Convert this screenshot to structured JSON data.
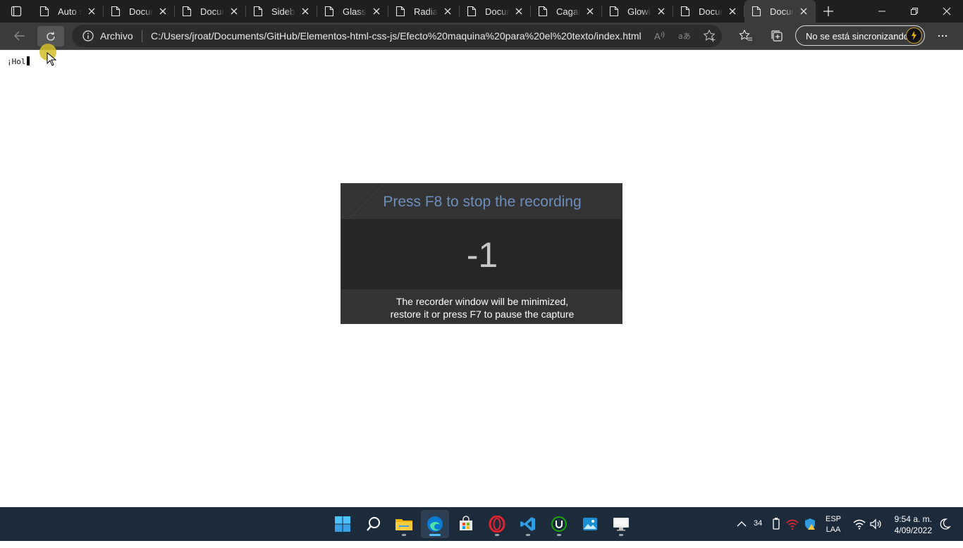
{
  "browser": {
    "tabs": [
      {
        "title": "Auto s"
      },
      {
        "title": "Docum"
      },
      {
        "title": "Docum"
      },
      {
        "title": "Sideba"
      },
      {
        "title": "Glassn"
      },
      {
        "title": "Radial"
      },
      {
        "title": "Docum"
      },
      {
        "title": "Cagan"
      },
      {
        "title": "Glowir"
      },
      {
        "title": "Docum"
      },
      {
        "title": "Docum",
        "active": true
      }
    ],
    "address": {
      "scheme_label": "Archivo",
      "url": "C:/Users/jroat/Documents/GitHub/Elementos-html-css-js/Efecto%20maquina%20para%20el%20texto/index.html"
    },
    "sync_label": "No se está sincronizando"
  },
  "page": {
    "typed_text": "¡Hol"
  },
  "recorder": {
    "title": "Press F8 to stop the recording",
    "countdown": "-1",
    "message_line1": "The recorder window will be minimized,",
    "message_line2": "restore it or press F7 to pause the capture"
  },
  "taskbar": {
    "apps": [
      "start-icon",
      "search-icon",
      "file-explorer-icon",
      "edge-icon",
      "store-icon",
      "opera-icon",
      "vscode-icon",
      "upwork-icon",
      "photos-icon",
      "remote-desktop-icon"
    ],
    "battery_count": "34",
    "lang_line1": "ESP",
    "lang_line2": "LAA",
    "time": "9:54 a. m.",
    "date": "4/09/2022"
  },
  "colors": {
    "tabstrip": "#1f1f1f",
    "toolbar": "#3b3b3b",
    "recorder_title": "#6c8ebf",
    "taskbar": "#1c2b3c",
    "accent": "#4cc2ff"
  }
}
